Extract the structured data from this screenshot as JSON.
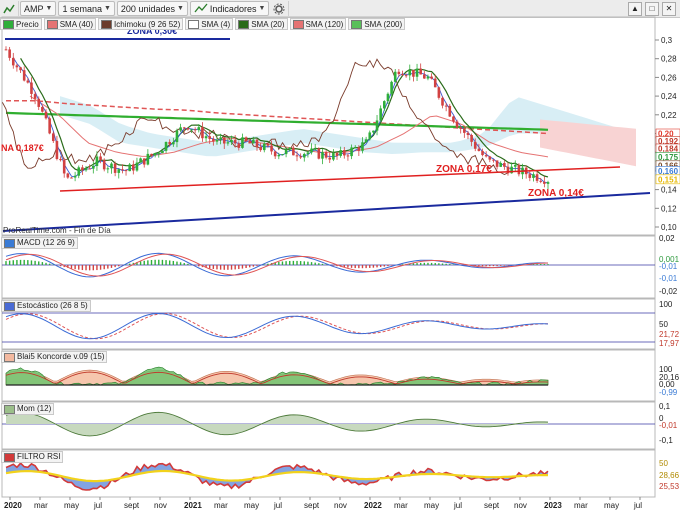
{
  "toolbar": {
    "symbol": "AMP",
    "period": "1 semana",
    "units": "200 unidades",
    "indicators": "Indicadores"
  },
  "legend": {
    "price": "Precio",
    "sma40": "SMA (40)",
    "ichimoku": "Ichimoku (9 26 52)",
    "sma4": "SMA (4)",
    "sma20": "SMA (20)",
    "sma120": "SMA (120)",
    "sma200": "SMA (200)"
  },
  "panels": {
    "macd": "MACD (12 26 9)",
    "stoch": "Estocástico (26 8 5)",
    "koncorde": "Blai5 Koncorde v.09 (15)",
    "mom": "Mom (12)",
    "rsi": "FILTRO RSI"
  },
  "annotations": {
    "zona_top": "ZONA 0,30€",
    "zona_left": "NA 0,187€",
    "zona_mid": "ZONA 0,17€",
    "zona_low": "ZONA 0,14€",
    "source": "ProRealTime.com - Fin de Día"
  },
  "price_axis": [
    "0,3",
    "0,28",
    "0,26",
    "0,24",
    "0,22",
    "0,20",
    "0,18",
    "0,16",
    "0,14",
    "0,12",
    "0,10"
  ],
  "price_tags": [
    {
      "text": "0,20",
      "color": "#e23b2e"
    },
    {
      "text": "0,192",
      "color": "#c0392b"
    },
    {
      "text": "0,184",
      "color": "#c0392b"
    },
    {
      "text": "0,175",
      "color": "#2e9a3e"
    },
    {
      "text": "0,166",
      "color": "#7a4a2a"
    },
    {
      "text": "0,160",
      "color": "#3a7bd5"
    },
    {
      "text": "0,151",
      "color": "#e6b800"
    }
  ],
  "macd_axis": [
    "0,02",
    "0,001",
    "-0,01",
    "-0,01",
    "-0,02"
  ],
  "stoch_axis": [
    "100",
    "50",
    "21,72",
    "17,97"
  ],
  "koncorde_axis": [
    "100",
    "20,16",
    "0,00",
    "-0,99"
  ],
  "mom_axis": [
    "0,1",
    "0",
    "-0,01",
    "-0,1"
  ],
  "rsi_axis": [
    "50",
    "28,66",
    "25,53"
  ],
  "time_axis": [
    "2020",
    "mar",
    "may",
    "jul",
    "sept",
    "nov",
    "2021",
    "mar",
    "may",
    "jul",
    "sept",
    "nov",
    "2022",
    "mar",
    "may",
    "jul",
    "sept",
    "nov",
    "2023",
    "mar",
    "may",
    "jul"
  ],
  "chart_data": {
    "type": "line",
    "title": "AMP",
    "xlabel": "",
    "ylabel": "",
    "ylim": [
      0.1,
      0.3
    ],
    "x": [
      "2020-01",
      "2020-03",
      "2020-05",
      "2020-07",
      "2020-09",
      "2020-11",
      "2021-01",
      "2021-03",
      "2021-05",
      "2021-07",
      "2021-09",
      "2021-11",
      "2022-01",
      "2022-03",
      "2022-05",
      "2022-07",
      "2022-09",
      "2022-11",
      "2022-12"
    ],
    "series": [
      {
        "name": "Precio",
        "values": [
          0.29,
          0.24,
          0.15,
          0.17,
          0.16,
          0.18,
          0.21,
          0.19,
          0.19,
          0.18,
          0.18,
          0.175,
          0.19,
          0.27,
          0.26,
          0.21,
          0.17,
          0.16,
          0.151
        ]
      },
      {
        "name": "SMA (40)",
        "values": [
          0.24,
          0.22,
          0.19,
          0.18,
          0.175,
          0.18,
          0.19,
          0.195,
          0.19,
          0.185,
          0.18,
          0.18,
          0.185,
          0.2,
          0.22,
          0.21,
          0.19,
          0.18,
          0.175
        ]
      },
      {
        "name": "SMA (120)",
        "values": [
          0.235,
          0.235,
          0.232,
          0.23,
          0.228,
          0.226,
          0.225,
          0.222,
          0.22,
          0.218,
          0.216,
          0.214,
          0.212,
          0.21,
          0.208,
          0.206,
          0.204,
          0.202,
          0.2
        ]
      },
      {
        "name": "SMA (200)",
        "values": [
          0.222,
          0.221,
          0.22,
          0.219,
          0.218,
          0.217,
          0.216,
          0.215,
          0.214,
          0.213,
          0.212,
          0.211,
          0.21,
          0.209,
          0.208,
          0.207,
          0.206,
          0.205,
          0.204
        ]
      }
    ],
    "levels": [
      {
        "name": "ZONA 0,30€",
        "value": 0.3
      },
      {
        "name": "ZONA 0,17€",
        "value": 0.17
      },
      {
        "name": "ZONA 0,14€",
        "value": 0.14
      }
    ],
    "grid": true,
    "legend": "top-left"
  },
  "colors": {
    "bull": "#2eae3a",
    "bear": "#d24141",
    "support": "#e02020",
    "trend": "#1a2a9e",
    "sma200": "#2fae2f",
    "sma120": "#e05555"
  }
}
